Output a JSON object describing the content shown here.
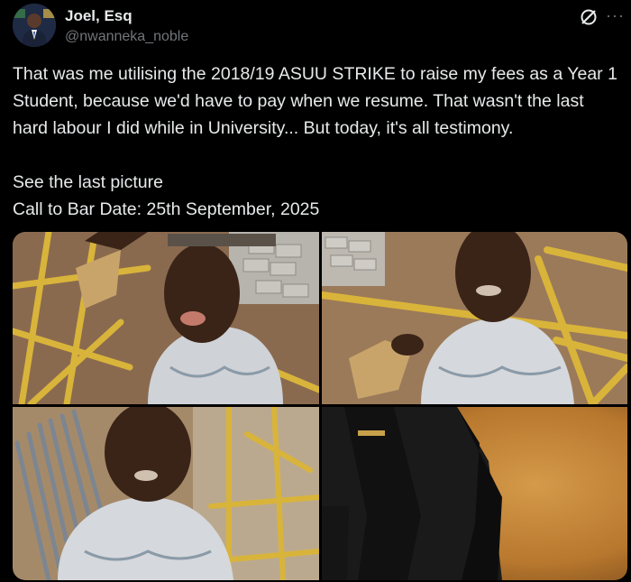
{
  "author": {
    "display_name": "Joel, Esq",
    "handle": "@nwanneka_noble"
  },
  "icons": {
    "grok": "grok-icon",
    "more": "more-icon"
  },
  "tweet": {
    "paragraph_1": "That was me utilising the 2018/19 ASUU STRIKE to raise my fees as a Year 1 Student, because we'd have to pay when we resume. That wasn't the last hard labour I did while in University... But today, it's all testimony.",
    "line_2": "See the last picture",
    "line_3": "Call to Bar Date: 25th September, 2025"
  },
  "media": {
    "count": 4,
    "images": [
      "selfie-with-scaffolding-and-cement-blocks",
      "selfie-holding-cement-bag-construction-site",
      "selfie-near-iron-rods-scaffolding",
      "wig-and-barrister-gown-on-orange-background"
    ]
  },
  "colors": {
    "background": "#000000",
    "text": "#e7e9ea",
    "secondary_text": "#71767b",
    "scaffold_yellow": "#d9b43a",
    "backdrop_orange": "#c98a3a"
  }
}
